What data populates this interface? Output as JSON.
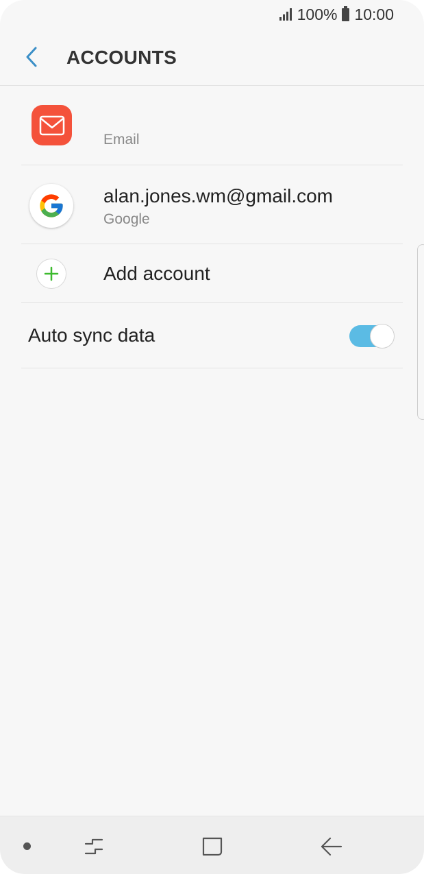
{
  "status_bar": {
    "battery_percent": "100%",
    "time": "10:00"
  },
  "header": {
    "title": "ACCOUNTS"
  },
  "accounts": [
    {
      "title": "",
      "subtitle": "Email",
      "icon": "email-icon",
      "icon_color": "#f4523b"
    },
    {
      "title": "alan.jones.wm@gmail.com",
      "subtitle": "Google",
      "icon": "google-icon"
    }
  ],
  "add_account": {
    "label": "Add account",
    "icon": "plus-icon",
    "icon_color": "#3dba2e"
  },
  "auto_sync": {
    "label": "Auto sync data",
    "enabled": true,
    "accent_color": "#5bbbe4"
  },
  "nav_bar": {
    "items": [
      "recent-apps-icon",
      "home-icon",
      "back-icon"
    ]
  }
}
